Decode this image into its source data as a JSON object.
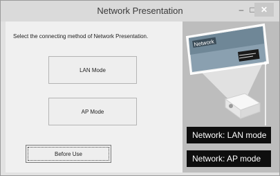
{
  "window": {
    "title": "Network Presentation",
    "minimize_glyph": "–",
    "maximize_glyph": "□",
    "close_glyph": "✕"
  },
  "main": {
    "instruction": "Select the connecting method of Network Presentation.",
    "lan_button_label": "LAN Mode",
    "ap_button_label": "AP Mode",
    "before_use_label": "Before Use"
  },
  "illustration": {
    "screen_label": "Network",
    "lan_label": "Network: LAN mode",
    "ap_label": "Network: AP mode"
  }
}
